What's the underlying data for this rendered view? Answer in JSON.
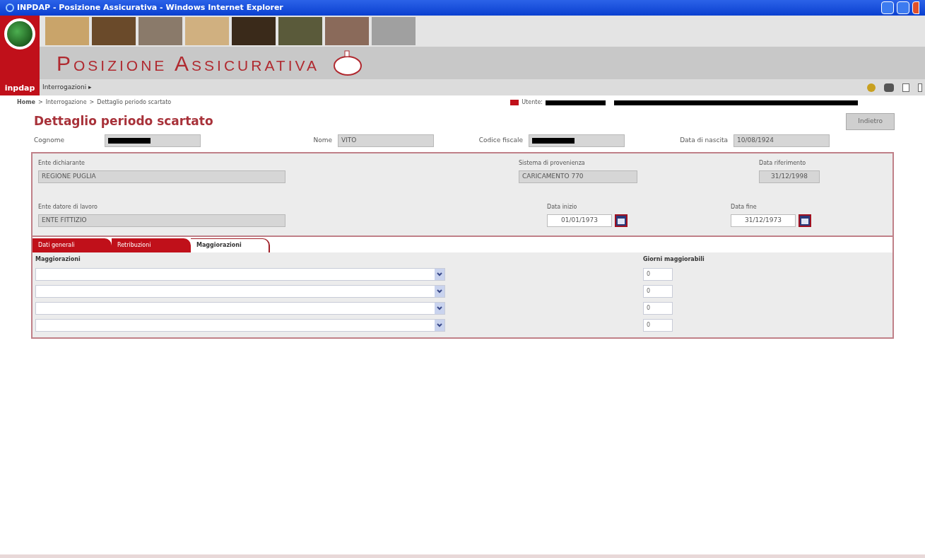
{
  "window": {
    "title": "INPDAP - Posizione Assicurativa - Windows Internet Explorer"
  },
  "banner": {
    "title": "Posizione Assicurativa",
    "logo_text": "inpdap"
  },
  "menu": {
    "items": [
      {
        "label": "Interrogazioni",
        "arrow": "▸"
      }
    ]
  },
  "breadcrumb": [
    {
      "label": "Home",
      "bold": true
    },
    {
      "label": "Interrogazione",
      "bold": false
    },
    {
      "label": "Dettaglio periodo scartato",
      "bold": false
    }
  ],
  "breadcrumb_separator": ">",
  "user": {
    "label": "Utente:"
  },
  "page": {
    "heading": "Dettaglio periodo scartato",
    "back_button": "Indietro"
  },
  "person": [
    {
      "label": "Cognome",
      "redacted": true
    },
    {
      "label": "Nome",
      "value": "VITO",
      "redacted": false
    },
    {
      "label": "Codice fiscale",
      "redacted": true
    },
    {
      "label": "Data di nascita",
      "value": "10/08/1924",
      "redacted": false
    }
  ],
  "details": {
    "ente_dichiarante": {
      "label": "Ente dichiarante",
      "value": "REGIONE PUGLIA"
    },
    "sistema": {
      "label": "Sistema di provenienza",
      "value": "CARICAMENTO 770"
    },
    "data_riferimento": {
      "label": "Data riferimento",
      "value": "31/12/1998"
    },
    "ente_datore": {
      "label": "Ente datore di lavoro",
      "value": "ENTE FITTIZIO"
    },
    "data_inizio": {
      "label": "Data inizio",
      "value": "01/01/1973"
    },
    "data_fine": {
      "label": "Data fine",
      "value": "31/12/1973"
    }
  },
  "tabs": [
    {
      "label": "Dati generali",
      "selected": false
    },
    {
      "label": "Retribuzioni",
      "selected": false
    },
    {
      "label": "Maggiorazioni",
      "selected": true
    }
  ],
  "maggiorazioni": {
    "column_1": "Maggiorazioni",
    "column_2": "Giorni maggiorabili",
    "rows": [
      {
        "giorni": "0"
      },
      {
        "giorni": "0"
      },
      {
        "giorni": "0"
      },
      {
        "giorni": "0"
      }
    ]
  }
}
